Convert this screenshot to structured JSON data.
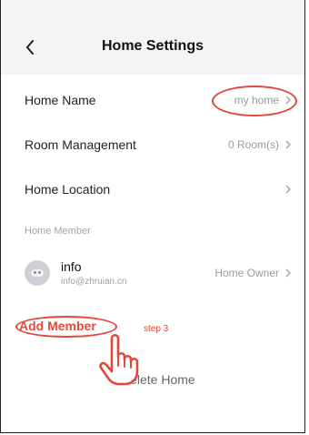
{
  "header": {
    "title": "Home Settings",
    "back_icon": "chevron-left-icon"
  },
  "settings": {
    "home_name": {
      "label": "Home Name",
      "value": "my home"
    },
    "room_management": {
      "label": "Room Management",
      "value": "0 Room(s)"
    },
    "home_location": {
      "label": "Home Location",
      "value": ""
    }
  },
  "members": {
    "section_title": "Home Member",
    "items": [
      {
        "name": "info",
        "email": "info@zhruian.cn",
        "role": "Home Owner"
      }
    ],
    "add_label": "Add Member"
  },
  "annotation": {
    "step_text": "step 3",
    "color": "#e2473a"
  },
  "delete_label": "Delete Home",
  "icons": {
    "chevron": "chevron-right-icon",
    "hand": "hand-pointer-icon"
  }
}
